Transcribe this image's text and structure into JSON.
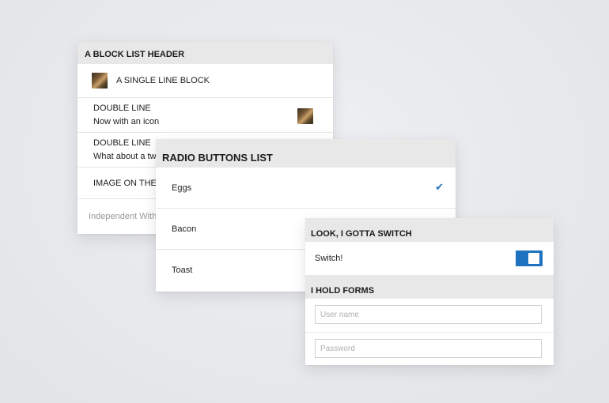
{
  "block_list": {
    "header": "A BLOCK LIST HEADER",
    "single_line": "A SINGLE LINE BLOCK",
    "double_line_1": {
      "title": "DOUBLE LINE",
      "subtitle": "Now with an icon"
    },
    "double_line_2": {
      "title": "DOUBLE LINE",
      "subtitle": "What about a tw"
    },
    "image_row": "IMAGE ON THE",
    "footer": "Independent With"
  },
  "radio_list": {
    "header": "RADIO BUTTONS LIST",
    "items": [
      {
        "label": "Eggs",
        "selected": true
      },
      {
        "label": "Bacon",
        "selected": false
      },
      {
        "label": "Toast",
        "selected": false
      }
    ],
    "check_color": "#1e73be"
  },
  "switch_panel": {
    "header": "LOOK, I GOTTA SWITCH",
    "switch_label": "Switch!",
    "switch_on": true,
    "switch_color": "#1e73be"
  },
  "forms_panel": {
    "header": "I HOLD FORMS",
    "username_placeholder": "User name",
    "password_placeholder": "Password"
  }
}
